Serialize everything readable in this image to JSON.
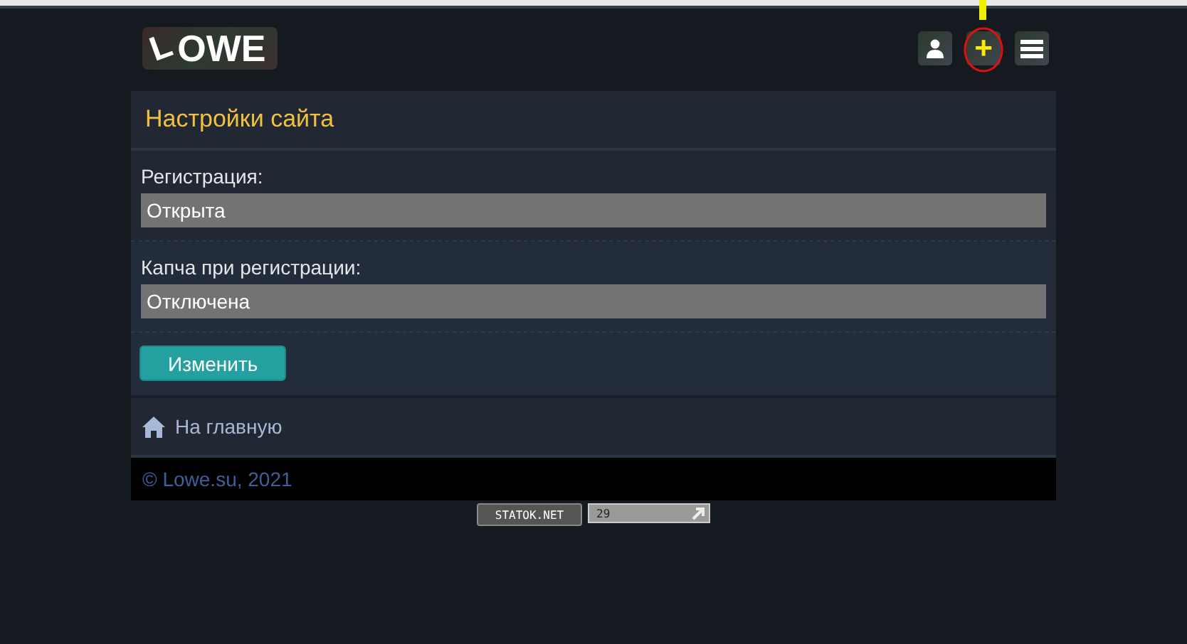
{
  "header": {
    "logo": {
      "letter": "L",
      "text": "OWE"
    },
    "buttons": [
      {
        "kind": "user"
      },
      {
        "kind": "add",
        "glyph": "+"
      },
      {
        "kind": "menu"
      }
    ]
  },
  "panel": {
    "title": "Настройки сайта",
    "fields": [
      {
        "label": "Регистрация:",
        "value": "Открыта"
      },
      {
        "label": "Капча при регистрации:",
        "value": "Отключена"
      }
    ],
    "submit": "Изменить"
  },
  "nav": {
    "home": "На главную"
  },
  "footer": {
    "copyright": "© Lowe.su, 2021"
  },
  "counters": [
    {
      "kind": "badge",
      "text": "STATOK.NET"
    },
    {
      "kind": "count",
      "text": "29"
    }
  ]
}
